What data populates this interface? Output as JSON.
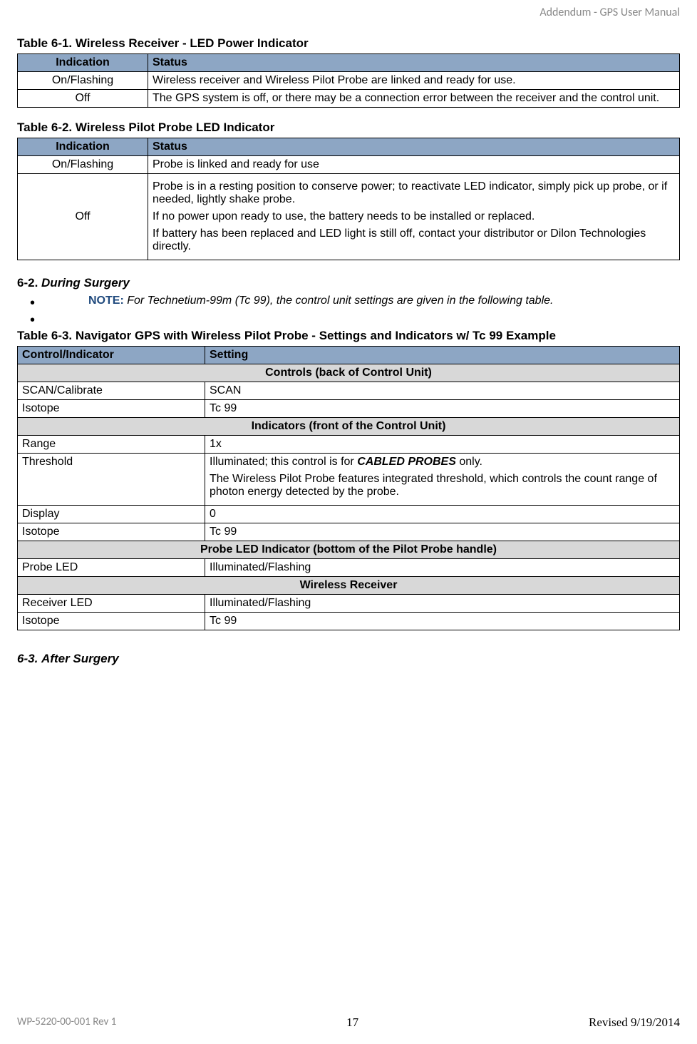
{
  "header": {
    "right": "Addendum - GPS User Manual"
  },
  "table61": {
    "title": "Table 6-1. Wireless Receiver - LED Power Indicator",
    "cols": {
      "indication": "Indication",
      "status": "Status"
    },
    "rows": [
      {
        "indication": "On/Flashing",
        "status": "Wireless receiver and Wireless Pilot Probe are linked and ready for use."
      },
      {
        "indication": "Off",
        "status": "The GPS system is off, or there may be a connection error between the receiver and the control unit."
      }
    ]
  },
  "table62": {
    "title": "Table 6-2.  Wireless Pilot Probe LED Indicator",
    "cols": {
      "indication": "Indication",
      "status": "Status"
    },
    "rows": [
      {
        "indication": "On/Flashing",
        "status": "Probe is linked and ready for use"
      },
      {
        "indication": "Off",
        "status_p1": "Probe is in a resting position to conserve power; to reactivate LED indicator, simply pick up probe, or if needed, lightly shake probe.",
        "status_p2": "If no power upon ready to use, the battery needs to be installed or replaced.",
        "status_p3": "If battery has been replaced and LED light is still off, contact your distributor or Dilon Technologies directly."
      }
    ]
  },
  "section62": {
    "num": "6-2.",
    "title": "During Surgery",
    "note_label": "NOTE:",
    "note_text": "  For Technetium-99m (Tc 99), the control unit settings are given in the following table."
  },
  "table63": {
    "title": "Table 6-3. Navigator GPS with Wireless Pilot Probe - Settings and Indicators w/ Tc 99 Example",
    "cols": {
      "control": "Control/Indicator",
      "setting": "Setting"
    },
    "sections": {
      "s1": "Controls (back of Control Unit)",
      "s2": "Indicators (front of the Control Unit)",
      "s3": "Probe LED Indicator (bottom of the Pilot Probe handle)",
      "s4": "Wireless Receiver"
    },
    "rows": {
      "r1": {
        "c": "SCAN/Calibrate",
        "s": "SCAN"
      },
      "r2": {
        "c": "Isotope",
        "s": "Tc 99"
      },
      "r3": {
        "c": "Range",
        "s": "1x"
      },
      "r4": {
        "c": "Threshold",
        "s_pre": "Illuminated; this control is for ",
        "s_bold": "CABLED PROBES",
        "s_post": " only.",
        "s_p2": "The Wireless Pilot Probe features integrated threshold, which controls the count range of photon energy detected by the probe."
      },
      "r5": {
        "c": "Display",
        "s": "0"
      },
      "r6": {
        "c": "Isotope",
        "s": "Tc 99"
      },
      "r7": {
        "c": "Probe LED",
        "s": "Illuminated/Flashing"
      },
      "r8": {
        "c": "Receiver LED",
        "s": "Illuminated/Flashing"
      },
      "r9": {
        "c": "Isotope",
        "s": "Tc 99"
      }
    }
  },
  "section63": {
    "num": "6-3.",
    "title": "After Surgery"
  },
  "footer": {
    "left": "WP-5220-00-001 Rev 1",
    "center": "17",
    "right": "Revised 9/19/2014"
  }
}
